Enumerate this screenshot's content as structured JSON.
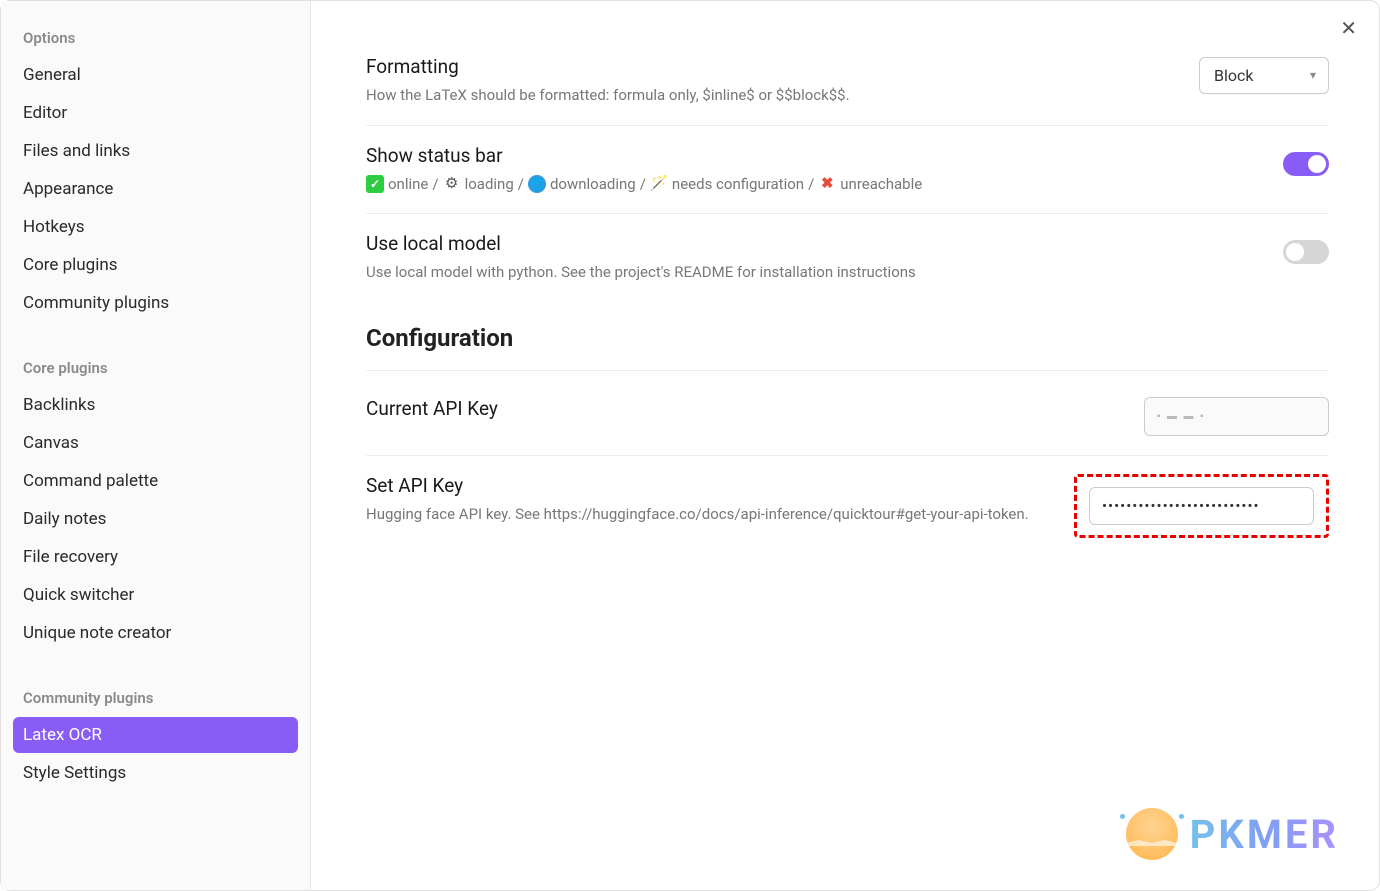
{
  "sidebar": {
    "sections": [
      {
        "header": "Options",
        "items": [
          "General",
          "Editor",
          "Files and links",
          "Appearance",
          "Hotkeys",
          "Core plugins",
          "Community plugins"
        ]
      },
      {
        "header": "Core plugins",
        "items": [
          "Backlinks",
          "Canvas",
          "Command palette",
          "Daily notes",
          "File recovery",
          "Quick switcher",
          "Unique note creator"
        ]
      },
      {
        "header": "Community plugins",
        "items": [
          "Latex OCR",
          "Style Settings"
        ]
      }
    ],
    "active": "Latex OCR"
  },
  "settings": {
    "formatting": {
      "title": "Formatting",
      "desc": "How the LaTeX should be formatted: formula only, $inline$ or $$block$$.",
      "value": "Block"
    },
    "status_bar": {
      "title": "Show status bar",
      "states": {
        "online": "online",
        "loading": "loading",
        "downloading": "downloading",
        "needs_config": "needs configuration",
        "unreachable": "unreachable"
      },
      "separator": " / ",
      "enabled": true
    },
    "local_model": {
      "title": "Use local model",
      "desc": "Use local model with python. See the project's README for installation instructions",
      "enabled": false
    },
    "config_heading": "Configuration",
    "current_api": {
      "title": "Current API Key",
      "masked": "▪ ▬ ▬ ▪"
    },
    "set_api": {
      "title": "Set API Key",
      "desc": "Hugging face API key. See https://huggingface.co/docs/api-inference/quicktour#get-your-api-token.",
      "value": "••••••••••••••••••••••••••"
    }
  },
  "watermark": "PKMER"
}
